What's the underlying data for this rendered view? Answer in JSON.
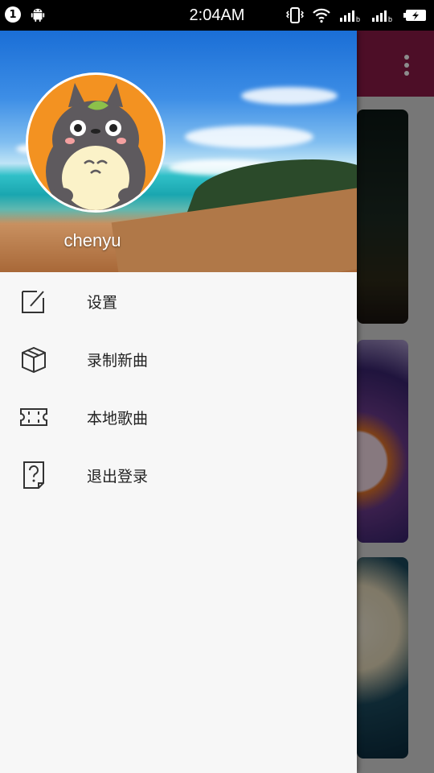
{
  "status_bar": {
    "notification_count": "1",
    "time": "2:04AM",
    "icons": [
      "android-icon",
      "vibrate-icon",
      "wifi-icon",
      "signal-icon",
      "signal-icon",
      "battery-icon"
    ]
  },
  "drawer": {
    "username": "chenyu",
    "items": [
      {
        "label": "设置",
        "icon": "edit-icon"
      },
      {
        "label": "录制新曲",
        "icon": "box-icon"
      },
      {
        "label": "本地歌曲",
        "icon": "ticket-icon"
      },
      {
        "label": "退出登录",
        "icon": "help-file-icon"
      }
    ]
  },
  "colors": {
    "toolbar": "#8c1b48",
    "avatar_bg": "#f39221",
    "drawer_bg": "#f7f7f7"
  }
}
